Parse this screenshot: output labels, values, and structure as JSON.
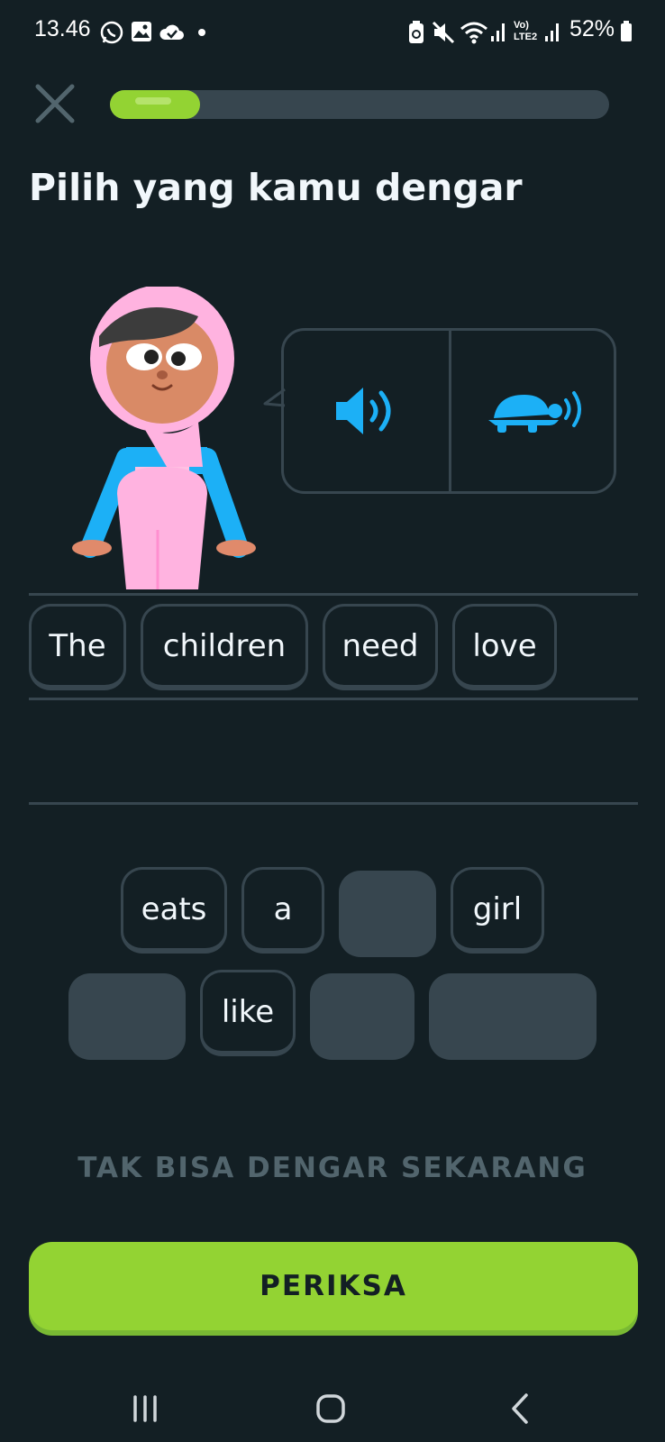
{
  "status_bar": {
    "time": "13.46",
    "battery": "52%",
    "network_label": "Vo) LTE2"
  },
  "lesson": {
    "progress_fraction": 0.18,
    "title": "Pilih yang kamu dengar"
  },
  "answer_words": [
    "The",
    "children",
    "need",
    "love"
  ],
  "word_bank": {
    "row1": [
      "eats",
      "a",
      "",
      "girl"
    ],
    "row2": [
      "",
      "like",
      "",
      ""
    ]
  },
  "cant_hear_label": "TAK BISA DENGAR SEKARANG",
  "check_button_label": "PERIKSA",
  "colors": {
    "background": "#131f24",
    "accent_green": "#93d333",
    "border": "#37464f",
    "audio_blue": "#1cb0f6",
    "muted_text": "#52656d"
  },
  "icons": {
    "close": "close-icon",
    "audio": "speaker-icon",
    "slow_audio": "turtle-icon"
  }
}
